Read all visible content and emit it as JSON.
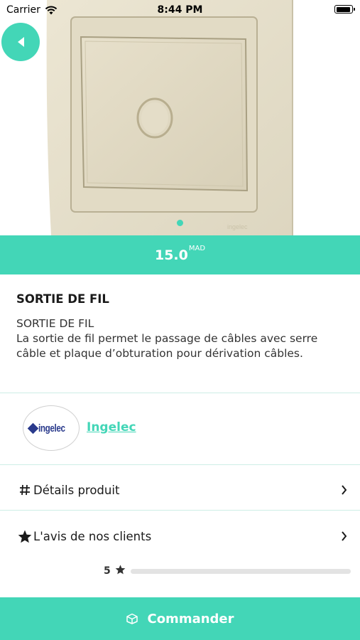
{
  "status_bar": {
    "carrier": "Carrier",
    "time": "8:44 PM"
  },
  "product": {
    "price": "15.0",
    "currency": "MAD",
    "title": "SORTIE DE FIL",
    "description": "SORTIE DE FIL\nLa sortie de fil permet le passage de câbles avec serre câble et plaque d’obturation pour dérivation câbles."
  },
  "brand": {
    "logo_text": "ingelec",
    "name": "Ingelec"
  },
  "sections": {
    "details_label": "Détails produit",
    "reviews_label": "L'avis de nos clients"
  },
  "ratings": [
    {
      "stars": "5",
      "fraction": 0
    }
  ],
  "order_button": {
    "label": "Commander"
  },
  "colors": {
    "accent": "#43d6b7",
    "brand_blue": "#2a3a8c"
  },
  "icons": {
    "back": "chevron-left-icon",
    "details": "hash-icon",
    "reviews": "star-icon",
    "order": "box-icon"
  }
}
